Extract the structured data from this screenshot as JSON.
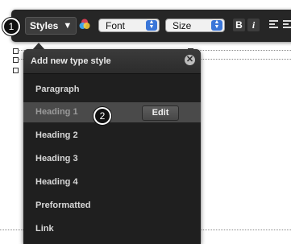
{
  "toolbar": {
    "styles_label": "Styles",
    "styles_arrow": "▼",
    "font_label": "Font",
    "size_label": "Size",
    "bold_label": "B",
    "italic_label": "i"
  },
  "badges": {
    "step1": "1",
    "step2": "2"
  },
  "popup": {
    "title": "Add new type style",
    "close_glyph": "✕",
    "edit_label": "Edit",
    "items": [
      {
        "label": "Paragraph"
      },
      {
        "label": "Heading 1",
        "selected": true
      },
      {
        "label": "Heading 2"
      },
      {
        "label": "Heading 3"
      },
      {
        "label": "Heading 4"
      },
      {
        "label": "Preformatted"
      },
      {
        "label": "Link"
      }
    ]
  },
  "colors": {
    "toolbar_bg": "#262626",
    "popup_bg": "#1f1f1f",
    "selected_row": "#4a4a4a",
    "spinner_blue": "#3a76d8"
  }
}
